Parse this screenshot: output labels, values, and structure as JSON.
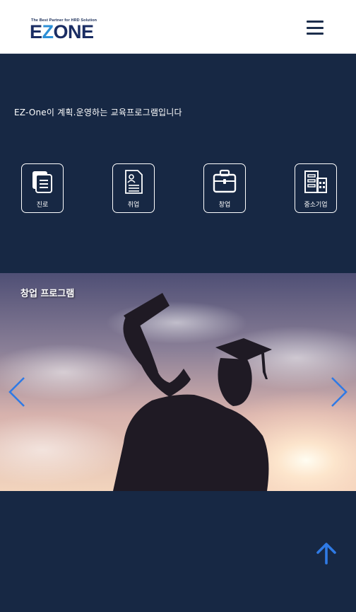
{
  "header": {
    "logo": {
      "tagline": "The Best Partner for HRD Solution",
      "wordmark_left": "E",
      "wordmark_z": "Z",
      "wordmark_right": "ONE"
    },
    "menu_icon": "hamburger-menu-icon"
  },
  "intro": {
    "text": "EZ-One이 계획.운영하는 교육프로그램입니다"
  },
  "categories": [
    {
      "label": "진로",
      "icon": "documents-icon"
    },
    {
      "label": "취업",
      "icon": "resume-icon"
    },
    {
      "label": "창업",
      "icon": "briefcase-icon"
    },
    {
      "label": "중소기업",
      "icon": "building-icon"
    }
  ],
  "slider": {
    "title": "창업 프로그램",
    "prev_icon": "chevron-left-icon",
    "next_icon": "chevron-right-icon"
  },
  "scroll_top_icon": "arrow-up-icon",
  "colors": {
    "background": "#172844",
    "header": "#ffffff",
    "accent": "#2f7ae5",
    "logo_blue": "#1a2d63",
    "logo_light_blue": "#2d8fd6"
  }
}
